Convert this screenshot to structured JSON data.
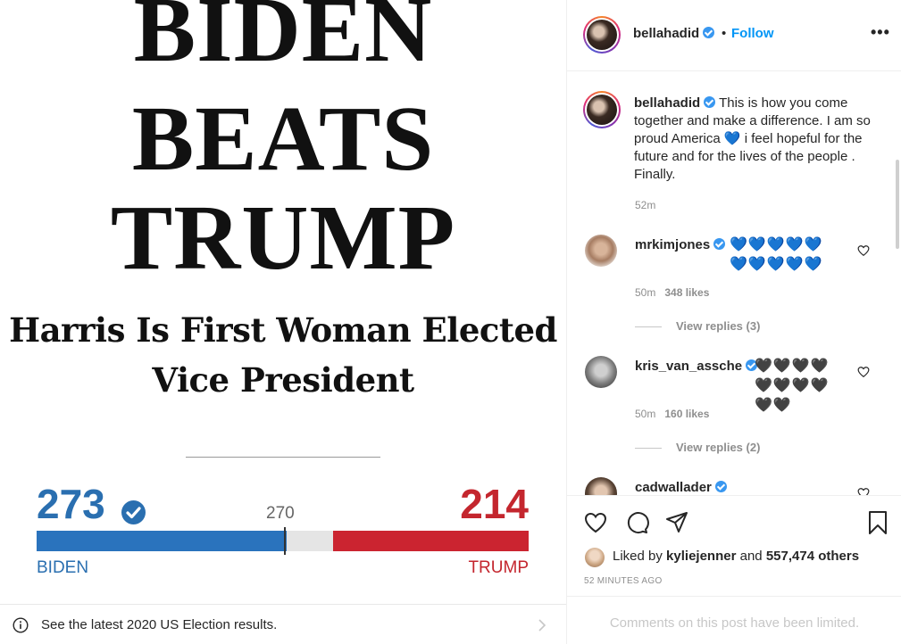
{
  "post_image": {
    "headline_lines": [
      "BIDEN",
      "BEATS",
      "TRUMP"
    ],
    "subhead_lines": [
      "Harris Is First Woman Elected",
      "Vice President"
    ],
    "biden_count": "273",
    "trump_count": "214",
    "threshold": "270",
    "biden_label": "BIDEN",
    "trump_label": "TRUMP",
    "electoral_total": 538,
    "colors": {
      "biden": "#2a73bd",
      "trump": "#cb2430"
    }
  },
  "election_banner": {
    "text": "See the latest 2020 US Election results."
  },
  "header": {
    "username": "bellahadid",
    "separator": "•",
    "follow_label": "Follow",
    "more_label": "•••"
  },
  "caption": {
    "username": "bellahadid",
    "text_before_heart": " This is how you come together and make a difference. I am so proud America ",
    "heart": "💙",
    "text_after_heart": " i feel hopeful for the future and for the lives of the people . Finally.",
    "time": "52m"
  },
  "comments": [
    {
      "username": "mrkimjones",
      "hearts": "💙💙💙💙💙💙💙💙💙💙",
      "time": "50m",
      "likes": "348 likes",
      "replies": "View replies (3)"
    },
    {
      "username": "kris_van_assche",
      "hearts": "🖤🖤🖤🖤🖤🖤🖤🖤🖤🖤",
      "time": "50m",
      "likes": "160 likes",
      "replies": "View replies (2)"
    },
    {
      "username": "cadwallader"
    }
  ],
  "likes": {
    "prefix": "Liked by ",
    "user": "kyliejenner",
    "middle": " and ",
    "others": "557,474 others"
  },
  "post_time": "52 MINUTES AGO",
  "comments_limited": "Comments on this post have been limited."
}
